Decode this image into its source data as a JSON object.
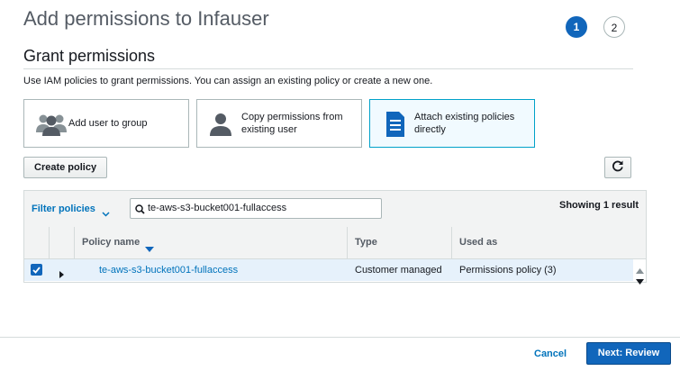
{
  "page": {
    "title": "Add permissions to Infauser",
    "steps": [
      "1",
      "2"
    ]
  },
  "section": {
    "title": "Grant permissions",
    "description": "Use IAM policies to grant permissions. You can assign an existing policy or create a new one."
  },
  "options": [
    {
      "label": "Add user to group",
      "icon": "users-group-icon"
    },
    {
      "label": "Copy permissions from existing user",
      "icon": "user-icon"
    },
    {
      "label": "Attach existing policies directly",
      "icon": "document-icon",
      "selected": true
    }
  ],
  "actions": {
    "create_policy": "Create policy",
    "refresh_icon": "refresh-icon"
  },
  "filter": {
    "label": "Filter policies",
    "search_value": "te-aws-s3-bucket001-fullaccess",
    "result_count": "Showing 1 result"
  },
  "table": {
    "columns": [
      "Policy name",
      "Type",
      "Used as"
    ],
    "rows": [
      {
        "checked": true,
        "policy_name": "te-aws-s3-bucket001-fullaccess",
        "type": "Customer managed",
        "used_as": "Permissions policy (3)"
      }
    ]
  },
  "footer": {
    "cancel": "Cancel",
    "next": "Next: Review"
  },
  "colors": {
    "primary": "#1166bb",
    "link": "#0073bb",
    "selected_row": "#e6f1fb"
  }
}
